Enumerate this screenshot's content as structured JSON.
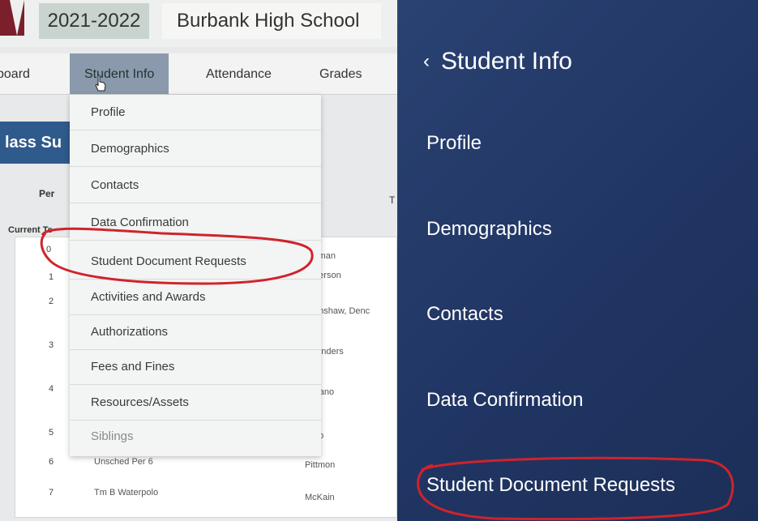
{
  "left": {
    "year": "2021-2022",
    "school": "Burbank High School",
    "nav": [
      "board",
      "Student Info",
      "Attendance",
      "Grades"
    ],
    "band_title": "lass Su",
    "col_per": "Per",
    "col_t": "T",
    "current_term": "Current Te",
    "dropdown": [
      "Profile",
      "Demographics",
      "Contacts",
      "Data Confirmation",
      "Student Document Requests",
      "Activities and Awards",
      "Authorizations",
      "Fees and Fines",
      "Resources/Assets",
      "Siblings"
    ],
    "rows": [
      {
        "num": "0",
        "teacher": "ittman"
      },
      {
        "num": "1",
        "teacher": "eterson"
      },
      {
        "num": "2",
        "teacher": "rimshaw, Denc"
      },
      {
        "num": "3",
        "teacher": "ounders"
      },
      {
        "num": "4",
        "teacher": "roano"
      },
      {
        "num": "5",
        "teacher": "/oo"
      },
      {
        "num": "6",
        "course": "Unsched Per 6",
        "teacher": "Pittmon"
      },
      {
        "num": "7",
        "course": "Tm B Waterpolo",
        "teacher": "McKain"
      }
    ]
  },
  "right": {
    "back_label": "Student Info",
    "items": [
      "Profile",
      "Demographics",
      "Contacts",
      "Data Confirmation",
      "Student Document Requests"
    ]
  },
  "colors": {
    "highlight_ring": "#d0232b",
    "mobile_bg": "#233868",
    "desktop_band": "#2f5a8c"
  }
}
